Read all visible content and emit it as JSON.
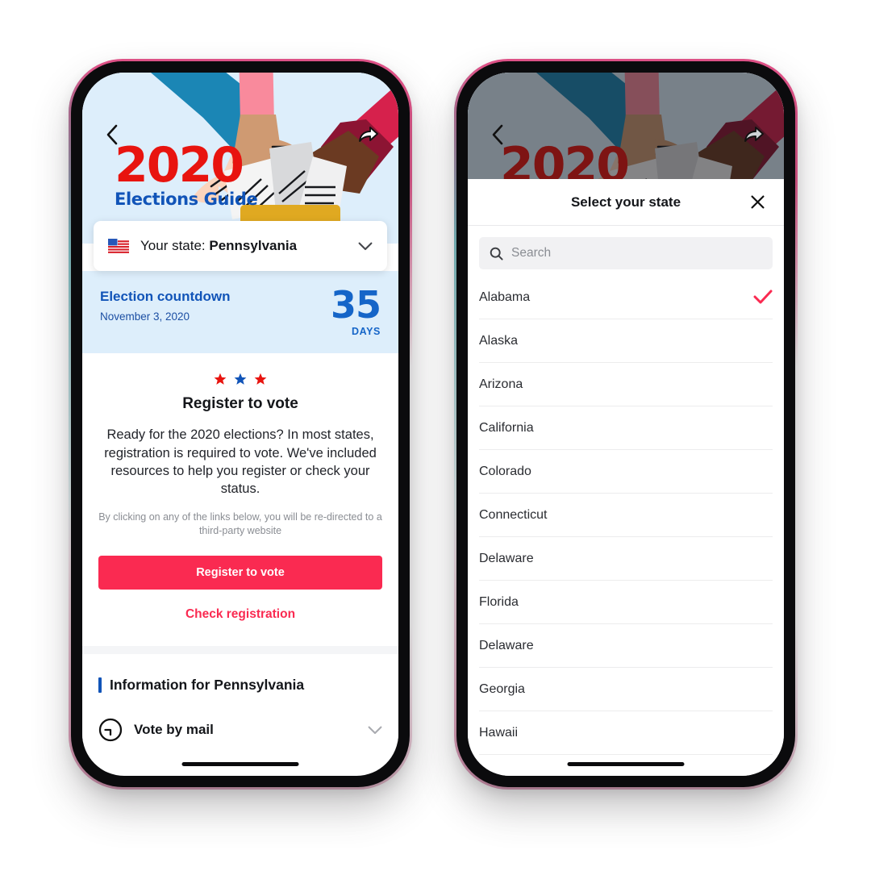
{
  "left_phone": {
    "nav": {
      "back_icon": "chevron-left-icon",
      "share_icon": "share-arrow-icon"
    },
    "hero": {
      "title_year": "2020",
      "title_sub": "Elections Guide",
      "alt": "Three arms in blue, pink and crimson sleeves dropping paper ballots into a gold ballot box"
    },
    "state_selector": {
      "flag_icon": "us-flag-icon",
      "label": "Your state: ",
      "state": "Pennsylvania",
      "chevron_icon": "chevron-down-icon"
    },
    "countdown": {
      "title": "Election countdown",
      "date": "November 3, 2020",
      "number": "35",
      "unit": "DAYS"
    },
    "register": {
      "stars_icon": "three-stars-icon",
      "heading": "Register to vote",
      "body": "Ready for the 2020 elections? In most states, registration is required to vote. We've included resources to help you register or check your status.",
      "disclaimer": "By clicking on any of the links below, you will be re-directed to a third-party website",
      "primary_button": "Register to vote",
      "secondary_link": "Check registration"
    },
    "info": {
      "title": "Information for Pennsylvania",
      "rows": [
        {
          "icon": "clock-icon",
          "label": "Vote by mail",
          "chevron_icon": "chevron-down-icon"
        }
      ]
    }
  },
  "right_phone": {
    "nav": {
      "back_icon": "chevron-left-icon",
      "share_icon": "share-arrow-icon"
    },
    "hero": {
      "title_year": "2020",
      "title_sub": "Elections Guide"
    },
    "modal": {
      "title": "Select your state",
      "close_icon": "close-x-icon",
      "search": {
        "icon": "search-icon",
        "placeholder": "Search",
        "value": ""
      },
      "selected_state": "Alabama",
      "check_icon": "checkmark-icon",
      "states": [
        "Alabama",
        "Alaska",
        "Arizona",
        "California",
        "Colorado",
        "Connecticut",
        "Delaware",
        "Florida",
        "Delaware",
        "Georgia",
        "Hawaii"
      ]
    }
  },
  "colors": {
    "hero_bg": "#ddeefb",
    "brand_red": "#e8140f",
    "brand_blue": "#1154b8",
    "countdown_blue": "#1565c8",
    "action_pink": "#fa2a51",
    "ballot_box": "#e0a921",
    "sleeve_blue": "#1b86b5",
    "sleeve_pink": "#f98a9c",
    "sleeve_crimson": "#d6214c",
    "skin_light": "#fbd4bd",
    "skin_tan": "#cf9a72",
    "skin_dark": "#6b3a22",
    "text_dark": "#14161a",
    "text_muted": "#8a8d93"
  }
}
